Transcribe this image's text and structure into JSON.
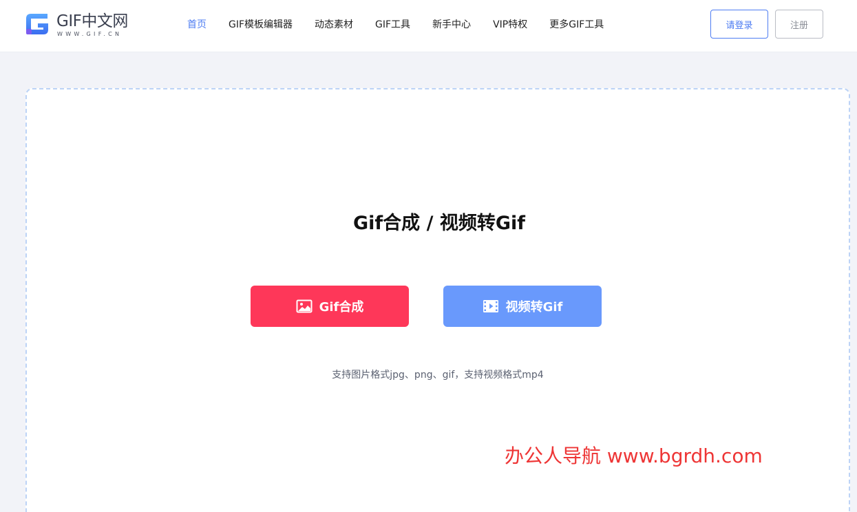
{
  "header": {
    "logo": {
      "title": "GIF中文网",
      "subtitle": "WWW.GIF.CN"
    },
    "nav": [
      {
        "label": "首页",
        "active": true
      },
      {
        "label": "GIF模板编辑器",
        "active": false
      },
      {
        "label": "动态素材",
        "active": false
      },
      {
        "label": "GIF工具",
        "active": false
      },
      {
        "label": "新手中心",
        "active": false
      },
      {
        "label": "VIP特权",
        "active": false
      },
      {
        "label": "更多GIF工具",
        "active": false
      }
    ],
    "login_label": "请登录",
    "register_label": "注册"
  },
  "main": {
    "title": "Gif合成 / 视频转Gif",
    "gif_button": {
      "label": "Gif合成",
      "icon": "image-icon"
    },
    "video_button": {
      "label": "视频转Gif",
      "icon": "film-icon"
    },
    "hint": "支持图片格式jpg、png、gif，支持视频格式mp4"
  },
  "watermark": "办公人导航 www.bgrdh.com",
  "colors": {
    "brand_blue": "#4d7cf2",
    "gif_button": "#fe3759",
    "video_button": "#6999fc",
    "page_bg": "#f2f3f8",
    "panel_border": "#bcd3f6",
    "watermark": "#ee3535"
  }
}
